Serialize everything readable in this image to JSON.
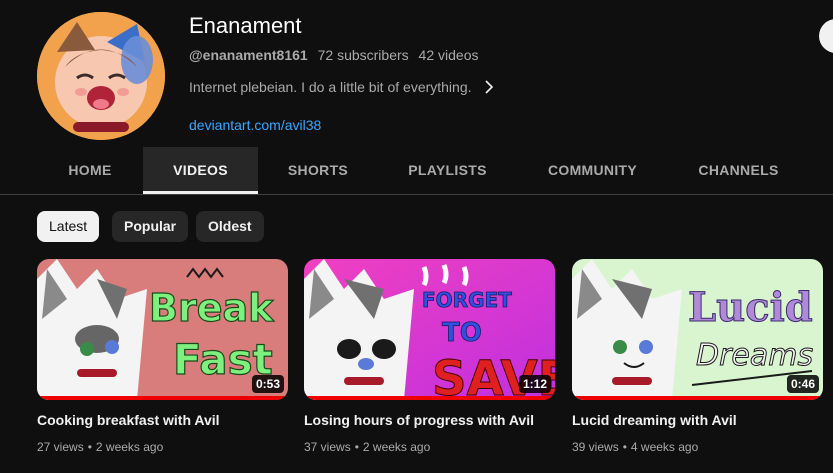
{
  "channel": {
    "name": "Enanament",
    "handle": "@enanament8161",
    "subscribers": "72 subscribers",
    "videos_count": "42 videos",
    "description": "Internet plebeian. I do a little bit of everything.",
    "link": "deviantart.com/avil38"
  },
  "tabs": [
    {
      "label": "HOME"
    },
    {
      "label": "VIDEOS"
    },
    {
      "label": "SHORTS"
    },
    {
      "label": "PLAYLISTS"
    },
    {
      "label": "COMMUNITY"
    },
    {
      "label": "CHANNELS"
    }
  ],
  "active_tab": "VIDEOS",
  "filters": [
    {
      "label": "Latest"
    },
    {
      "label": "Popular"
    },
    {
      "label": "Oldest"
    }
  ],
  "active_filter": "Latest",
  "videos": [
    {
      "title": "Cooking breakfast with Avil",
      "views": "27 views",
      "age": "2 weeks ago",
      "duration": "0:53",
      "thumb_text_1": "Break",
      "thumb_text_2": "Fast",
      "thumb_bg": "#d97c7c"
    },
    {
      "title": "Losing hours of progress with Avil",
      "views": "37 views",
      "age": "2 weeks ago",
      "duration": "1:12",
      "thumb_text_1": "FORGET",
      "thumb_text_2": "TO",
      "thumb_text_3": "SAVE",
      "thumb_bg": "#e040c8"
    },
    {
      "title": "Lucid dreaming with Avil",
      "views": "39 views",
      "age": "4 weeks ago",
      "duration": "0:46",
      "thumb_text_1": "Lucid",
      "thumb_text_2": "Dreams",
      "thumb_bg": "#d8f5d0"
    }
  ],
  "colors": {
    "background": "#0f0f0f",
    "link": "#3ea6ff",
    "progress": "#ee0000",
    "chip_bg": "#272727"
  }
}
